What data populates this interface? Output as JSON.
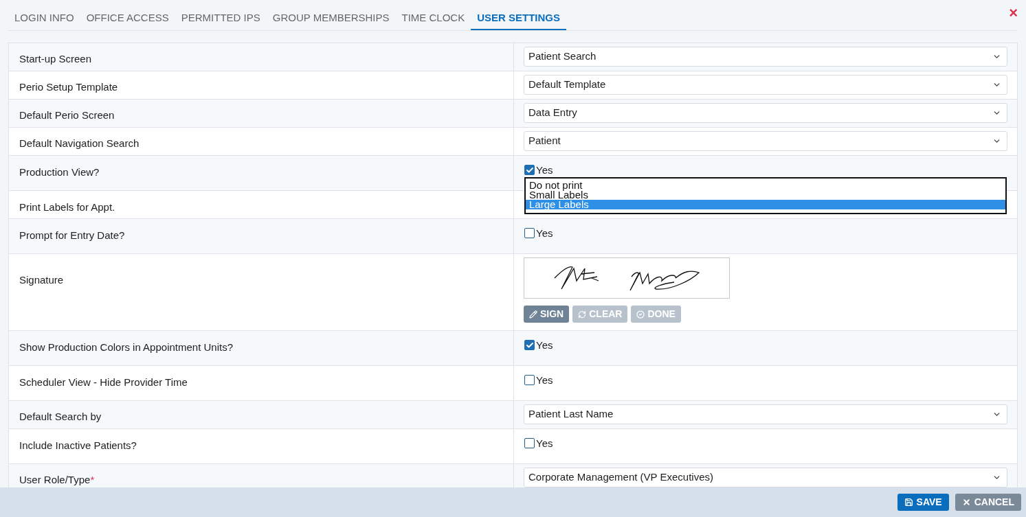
{
  "tabs": [
    {
      "label": "LOGIN INFO",
      "selected": false
    },
    {
      "label": "OFFICE ACCESS",
      "selected": false
    },
    {
      "label": "PERMITTED IPS",
      "selected": false
    },
    {
      "label": "GROUP MEMBERSHIPS",
      "selected": false
    },
    {
      "label": "TIME CLOCK",
      "selected": false
    },
    {
      "label": "USER SETTINGS",
      "selected": true
    }
  ],
  "close_label": "×",
  "settings": [
    {
      "kind": "select",
      "label": "Start-up Screen",
      "value": "Patient Search"
    },
    {
      "kind": "select",
      "label": "Perio Setup Template",
      "value": "Default Template"
    },
    {
      "kind": "select",
      "label": "Default Perio Screen",
      "value": "Data Entry"
    },
    {
      "kind": "select",
      "label": "Default Navigation Search",
      "value": "Patient"
    },
    {
      "kind": "checkbox",
      "label": "Production View?",
      "checked": true,
      "option": "Yes"
    },
    {
      "kind": "listbox",
      "label": "Print Labels for Appt.",
      "options": [
        {
          "label": "Do not print",
          "selected": false
        },
        {
          "label": "Small Labels",
          "selected": false
        },
        {
          "label": "Large Labels",
          "selected": true
        }
      ]
    },
    {
      "kind": "checkbox",
      "label": "Prompt for Entry Date?",
      "checked": false,
      "option": "Yes"
    },
    {
      "kind": "signature",
      "label": "Signature",
      "buttons": [
        {
          "label": "SIGN",
          "disabled": false
        },
        {
          "label": "CLEAR",
          "disabled": true
        },
        {
          "label": "DONE",
          "disabled": true
        }
      ]
    },
    {
      "kind": "checkbox",
      "label": "Show Production Colors in Appointment Units?",
      "checked": true,
      "option": "Yes"
    },
    {
      "kind": "checkbox",
      "label": "Scheduler View - Hide Provider Time",
      "checked": false,
      "option": "Yes"
    },
    {
      "kind": "select",
      "label": "Default Search by",
      "value": "Patient Last Name"
    },
    {
      "kind": "checkbox",
      "label": "Include Inactive Patients?",
      "checked": false,
      "option": "Yes"
    },
    {
      "kind": "select",
      "label": "User Role/Type",
      "required": true,
      "required_mark": "*",
      "value": "Corporate Management (VP Executives)"
    }
  ],
  "footer": {
    "save": "SAVE",
    "cancel": "CANCEL"
  }
}
